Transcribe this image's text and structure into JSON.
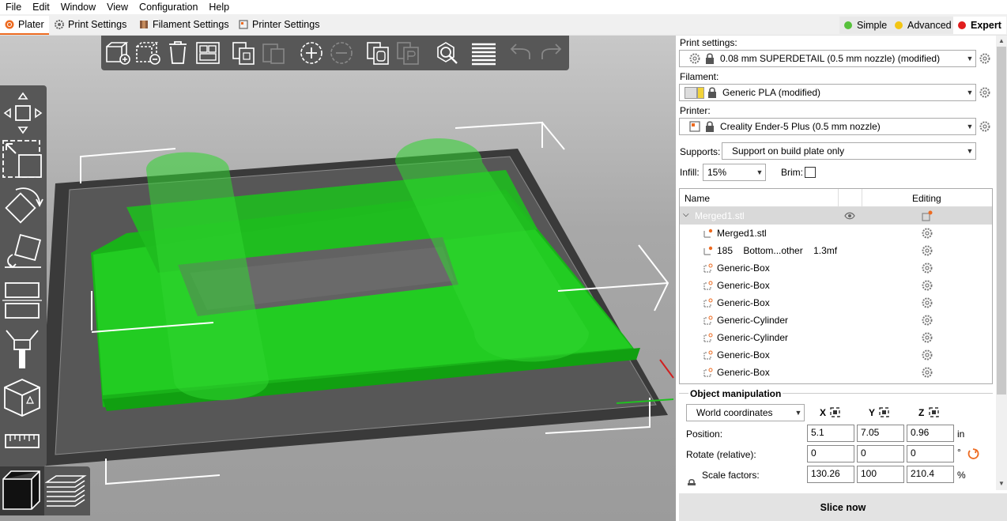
{
  "menu": [
    "File",
    "Edit",
    "Window",
    "View",
    "Configuration",
    "Help"
  ],
  "tabs": [
    {
      "label": "Plater",
      "icon": "plater-icon",
      "active": true
    },
    {
      "label": "Print Settings",
      "icon": "print-settings-icon",
      "active": false
    },
    {
      "label": "Filament Settings",
      "icon": "filament-settings-icon",
      "active": false
    },
    {
      "label": "Printer Settings",
      "icon": "printer-settings-icon",
      "active": false
    }
  ],
  "modes": [
    {
      "label": "Simple",
      "color": "#57c13b",
      "selected": false
    },
    {
      "label": "Advanced",
      "color": "#f3c513",
      "selected": false
    },
    {
      "label": "Expert",
      "color": "#e11d1d",
      "selected": true
    }
  ],
  "right_panel": {
    "print_settings_label": "Print settings:",
    "print_settings_value": "0.08 mm SUPERDETAIL (0.5 mm nozzle) (modified)",
    "filament_label": "Filament:",
    "filament_value": "Generic PLA (modified)",
    "filament_color": "#f2d33a",
    "printer_label": "Printer:",
    "printer_value": "Creality Ender-5 Plus (0.5 mm nozzle)",
    "supports_label": "Supports:",
    "supports_value": "Support on build plate only",
    "infill_label": "Infill:",
    "infill_value": "15%",
    "brim_label": "Brim:"
  },
  "object_list": {
    "col_name": "Name",
    "col_editing": "Editing",
    "root": "Merged1.stl",
    "items": [
      {
        "name": "Merged1.stl",
        "type": "part"
      },
      {
        "name": "185    Bottom...other    1.3mf",
        "type": "part"
      },
      {
        "name": "Generic-Box",
        "type": "modifier"
      },
      {
        "name": "Generic-Box",
        "type": "modifier"
      },
      {
        "name": "Generic-Box",
        "type": "modifier"
      },
      {
        "name": "Generic-Cylinder",
        "type": "modifier"
      },
      {
        "name": "Generic-Cylinder",
        "type": "modifier"
      },
      {
        "name": "Generic-Box",
        "type": "modifier"
      },
      {
        "name": "Generic-Box",
        "type": "modifier"
      }
    ]
  },
  "object_manipulation": {
    "title": "Object manipulation",
    "coord_system": "World coordinates",
    "axes": [
      "X",
      "Y",
      "Z"
    ],
    "position_label": "Position:",
    "position": [
      "5.1",
      "7.05",
      "0.96"
    ],
    "position_unit": "in",
    "rotate_label": "Rotate (relative):",
    "rotate": [
      "0",
      "0",
      "0"
    ],
    "rotate_unit": "°",
    "scale_label": "Scale factors:",
    "scale": [
      "130.26",
      "100",
      "210.4"
    ],
    "scale_unit": "%"
  },
  "slice_button": "Slice now",
  "colors": {
    "accent": "#ed6b21",
    "model": "#22cc22",
    "toolbar": "#575757"
  }
}
